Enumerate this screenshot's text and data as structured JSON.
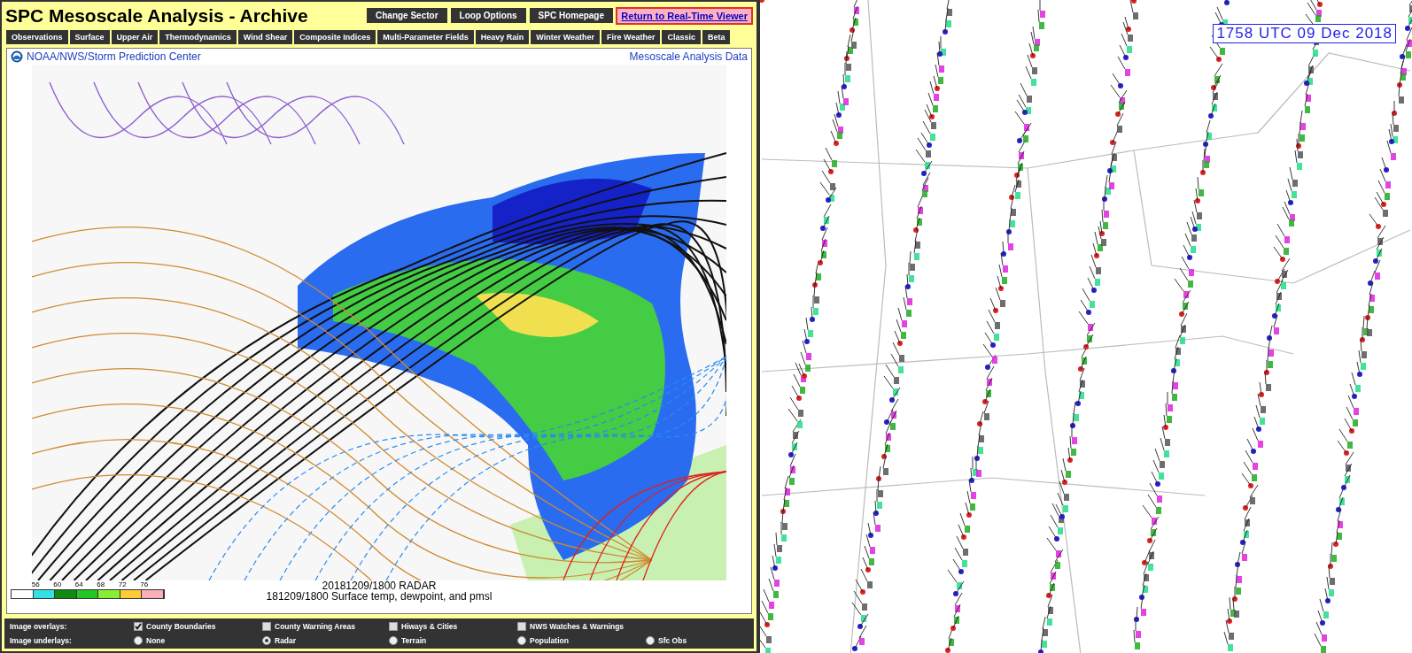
{
  "header": {
    "title": "SPC Mesoscale Analysis - Archive",
    "buttons": [
      "Change Sector",
      "Loop Options",
      "SPC Homepage"
    ],
    "return_link": "Return to Real-Time Viewer"
  },
  "nav": {
    "items": [
      {
        "label": "Observations"
      },
      {
        "label": "Surface"
      },
      {
        "label": "Upper Air"
      },
      {
        "label": "Thermodynamics"
      },
      {
        "label": "Wind Shear"
      },
      {
        "label": "Composite Indices"
      },
      {
        "label": "Multi-Parameter Fields"
      },
      {
        "label": "Heavy Rain"
      },
      {
        "label": "Winter Weather"
      },
      {
        "label": "Fire Weather"
      },
      {
        "label": "Classic"
      },
      {
        "label": "Beta"
      }
    ]
  },
  "map": {
    "source": "NOAA/NWS/Storm Prediction Center",
    "data_title": "Mesoscale Analysis Data",
    "radar_caption": "20181209/1800 RADAR",
    "caption": "181209/1800 Surface temp, dewpoint, and pmsl",
    "legend": {
      "labels": [
        "56",
        "60",
        "64",
        "68",
        "72",
        "76"
      ],
      "swatches": [
        {
          "color": "#ffffff"
        },
        {
          "color": "#33e0e8"
        },
        {
          "color": "#108a10"
        },
        {
          "color": "#22c822"
        },
        {
          "color": "#88ee33"
        },
        {
          "color": "#ffcc33"
        },
        {
          "color": "#f8b0b8"
        }
      ]
    }
  },
  "overlays": {
    "label": "Image overlays:",
    "items": [
      {
        "label": "County Boundaries",
        "checked": true
      },
      {
        "label": "County Warning Areas",
        "checked": false
      },
      {
        "label": "Hiways & Cities",
        "checked": false
      },
      {
        "label": "NWS Watches & Warnings",
        "checked": false
      }
    ]
  },
  "underlays": {
    "label": "Image underlays:",
    "items": [
      {
        "label": "None",
        "selected": false
      },
      {
        "label": "Radar",
        "selected": true
      },
      {
        "label": "Terrain",
        "selected": false
      },
      {
        "label": "Population",
        "selected": false
      },
      {
        "label": "Sfc Obs",
        "selected": false
      }
    ]
  },
  "station_map": {
    "timestamp": "1758 UTC 09 Dec 2018"
  }
}
